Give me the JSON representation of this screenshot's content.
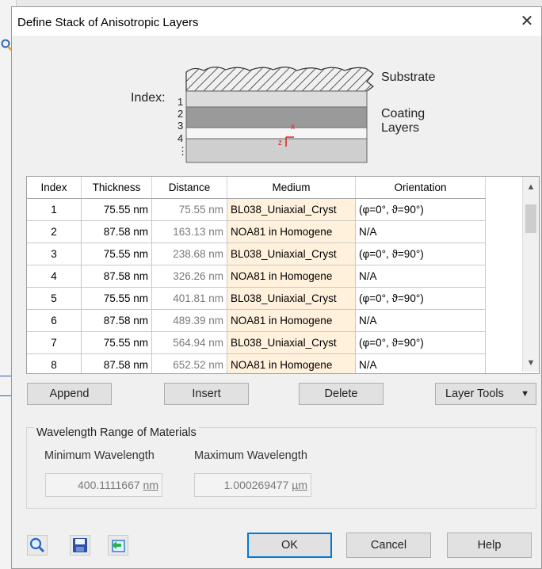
{
  "dialog": {
    "title": "Define Stack of Anisotropic Layers",
    "close_symbol": "✕"
  },
  "diagram": {
    "index_label": "Index:",
    "indices": [
      "1",
      "2",
      "3",
      "4",
      "⋮"
    ],
    "substrate_label": "Substrate",
    "coating_label_1": "Coating",
    "coating_label_2": "Layers",
    "axis_x": "x",
    "axis_z": "z"
  },
  "table": {
    "columns": [
      "Index",
      "Thickness",
      "Distance",
      "Medium",
      "Orientation"
    ],
    "rows": [
      {
        "index": "1",
        "thickness": "75.55 nm",
        "distance": "75.55 nm",
        "medium": "BL038_Uniaxial_Cryst",
        "orientation": "(φ=0°, ϑ=90°)"
      },
      {
        "index": "2",
        "thickness": "87.58 nm",
        "distance": "163.13 nm",
        "medium": "NOA81 in Homogene",
        "orientation": "N/A"
      },
      {
        "index": "3",
        "thickness": "75.55 nm",
        "distance": "238.68 nm",
        "medium": "BL038_Uniaxial_Cryst",
        "orientation": "(φ=0°, ϑ=90°)"
      },
      {
        "index": "4",
        "thickness": "87.58 nm",
        "distance": "326.26 nm",
        "medium": "NOA81 in Homogene",
        "orientation": "N/A"
      },
      {
        "index": "5",
        "thickness": "75.55 nm",
        "distance": "401.81 nm",
        "medium": "BL038_Uniaxial_Cryst",
        "orientation": "(φ=0°, ϑ=90°)"
      },
      {
        "index": "6",
        "thickness": "87.58 nm",
        "distance": "489.39 nm",
        "medium": "NOA81 in Homogene",
        "orientation": "N/A"
      },
      {
        "index": "7",
        "thickness": "75.55 nm",
        "distance": "564.94 nm",
        "medium": "BL038_Uniaxial_Cryst",
        "orientation": "(φ=0°, ϑ=90°)"
      },
      {
        "index": "8",
        "thickness": "87.58 nm",
        "distance": "652.52 nm",
        "medium": "NOA81 in Homogene",
        "orientation": "N/A"
      }
    ]
  },
  "buttons": {
    "append": "Append",
    "insert": "Insert",
    "delete": "Delete",
    "layer_tools": "Layer Tools",
    "ok": "OK",
    "cancel": "Cancel",
    "help": "Help"
  },
  "wavelength": {
    "group_title": "Wavelength Range of Materials",
    "min_label": "Minimum Wavelength",
    "max_label": "Maximum Wavelength",
    "min_value": "400.1111667",
    "min_unit": "nm",
    "max_value": "1.000269477",
    "max_unit": "µm"
  },
  "icons": [
    "search-icon",
    "save-icon",
    "export-icon"
  ],
  "colors": {
    "medium_cell_bg": "#fff1dc",
    "ok_border": "#0078d7",
    "diagram_axis": "#e02020"
  }
}
